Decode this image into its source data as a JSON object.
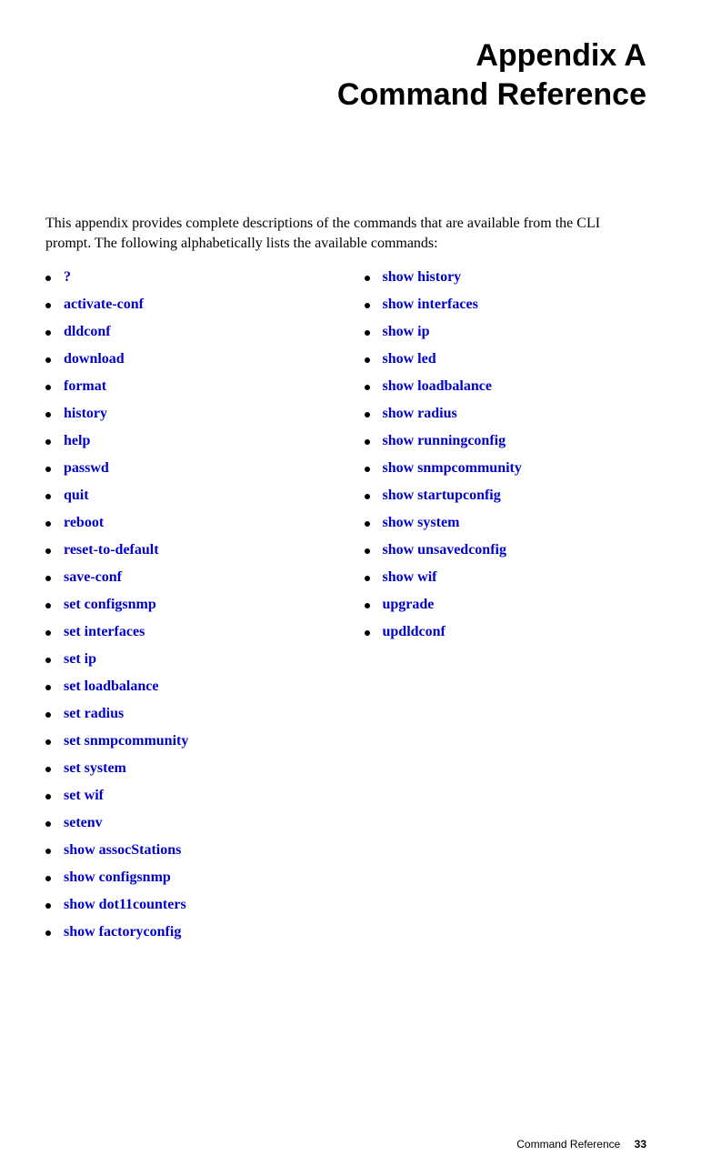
{
  "title": {
    "line1": "Appendix A",
    "line2": "Command Reference"
  },
  "intro": "This appendix provides complete descriptions of the commands that are available from the CLI prompt. The following alphabetically lists the available commands:",
  "commands_left": [
    "?",
    "activate-conf",
    "dldconf",
    "download",
    "format",
    "history",
    "help",
    "passwd",
    "quit",
    "reboot",
    "reset-to-default",
    "save-conf",
    "set configsnmp",
    "set interfaces",
    "set ip",
    "set loadbalance",
    "set radius",
    "set snmpcommunity",
    "set system",
    "set wif",
    "setenv",
    "show assocStations",
    "show configsnmp",
    "show dot11counters",
    "show factoryconfig"
  ],
  "commands_right": [
    "show history",
    "show interfaces",
    "show ip",
    "show led",
    "show loadbalance",
    "show radius",
    "show runningconfig",
    "show snmpcommunity",
    "show startupconfig",
    "show system",
    "show unsavedconfig",
    "show wif",
    "upgrade",
    "updldconf"
  ],
  "footer": {
    "label": "Command Reference",
    "page": "33"
  }
}
